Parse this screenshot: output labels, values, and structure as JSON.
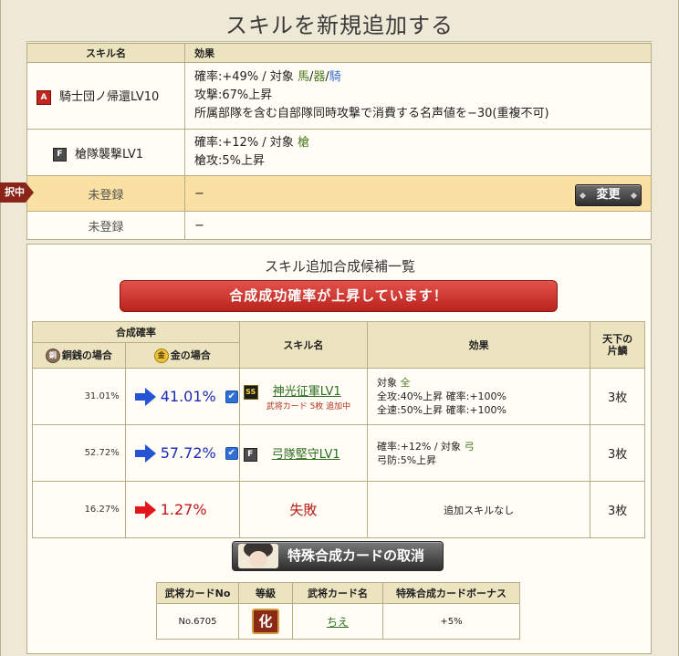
{
  "page": {
    "title": "スキルを新規追加する"
  },
  "skills_table": {
    "header_name": "スキル名",
    "header_effect": "効果",
    "rows": [
      {
        "rank": "A",
        "name": "騎士団ノ帰還LV10",
        "effect_line1_prefix": "確率:+49% / 対象 ",
        "target_horse": "馬",
        "target_sep1": "/",
        "target_vessel": "器",
        "target_sep2": "/",
        "target_cav": "騎",
        "effect_line2": "攻撃:67%上昇",
        "effect_line3": "所属部隊を含む自部隊同時攻撃で消費する名声値を−30(重複不可)"
      },
      {
        "rank": "F",
        "name": "槍隊襲撃LV1",
        "effect_line1_prefix": "確率:+12% / 対象 ",
        "target": "槍",
        "effect_line2": "槍攻:5%上昇"
      },
      {
        "name": "未登録",
        "effect": "−",
        "selected": true,
        "selection_tag": "択中",
        "change_button": "変更"
      },
      {
        "name": "未登録",
        "effect": "−"
      }
    ]
  },
  "candidates": {
    "title": "スキル追加合成候補一覧",
    "banner": "合成成功確率が上昇しています！",
    "headers": {
      "rate": "合成確率",
      "copper": "銅銭の場合",
      "copper_icon": "銅",
      "gold": "金の場合",
      "gold_icon": "金",
      "skill_name": "スキル名",
      "effect": "効果",
      "tenka_line1": "天下の",
      "tenka_line2": "片鱗"
    },
    "rows": [
      {
        "copper_rate": "31.01%",
        "gold_rate": "41.01%",
        "checked": true,
        "badge": "SS",
        "skill": "神光征軍LV1",
        "note": "武将カード 5枚 追加中",
        "effect_line1_prefix": "対象 ",
        "effect_target": "全",
        "effect_line2": "全攻:40%上昇 確率:+100%",
        "effect_line3": "全速:50%上昇 確率:+100%",
        "tenka": "3枚"
      },
      {
        "copper_rate": "52.72%",
        "gold_rate": "57.72%",
        "checked": true,
        "badge": "F",
        "skill": "弓隊堅守LV1",
        "effect_line1_prefix": "確率:+12% / 対象 ",
        "effect_target": "弓",
        "effect_line2": "弓防:5%上昇",
        "tenka": "3枚"
      },
      {
        "copper_rate": "16.27%",
        "gold_rate": "1.27%",
        "result": "失敗",
        "effect": "追加スキルなし",
        "tenka": "3枚"
      }
    ],
    "cancel_button": "特殊合成カードの取消",
    "card_table": {
      "headers": [
        "武将カードNo",
        "等級",
        "武将カード名",
        "特殊合成カードボーナス"
      ],
      "row": {
        "no": "No.6705",
        "grade": "化",
        "name": "ちえ",
        "bonus": "+5%"
      }
    }
  },
  "colors": {
    "background": "#eee8d6",
    "header_bg": "#ece3bf",
    "selected_row": "#fae0a2",
    "banner_red": "#c8322b",
    "link_green": "#2b6e1f",
    "rate_blue": "#1b2ab8",
    "rate_red": "#c0141b"
  },
  "icons": [
    "checkbox-checked-icon",
    "blue-arrow-icon",
    "red-arrow-icon",
    "copper-coin-icon",
    "gold-coin-icon"
  ]
}
